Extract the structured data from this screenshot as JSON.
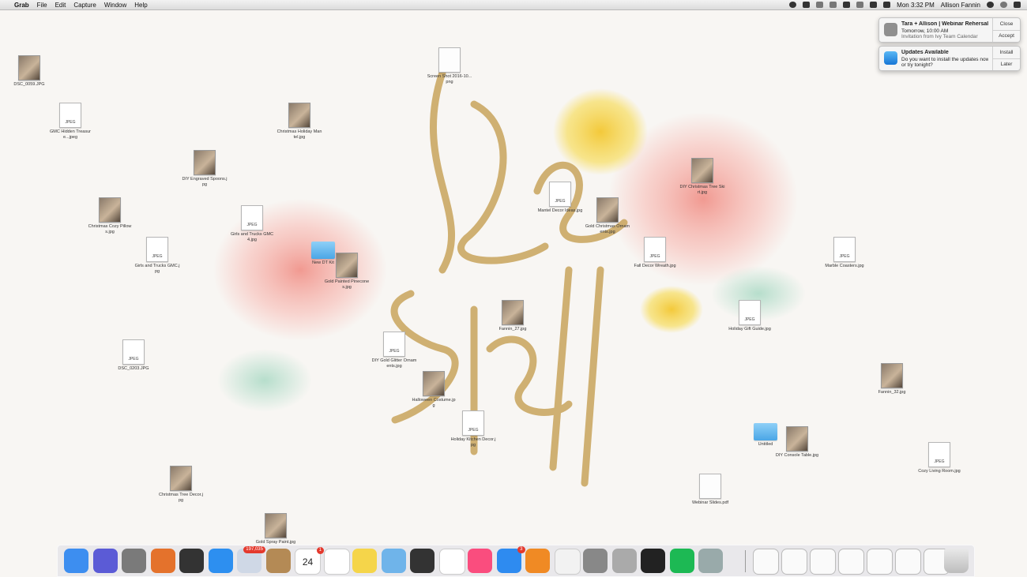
{
  "menubar": {
    "app_name": "Grab",
    "menus": [
      "File",
      "Edit",
      "Capture",
      "Window",
      "Help"
    ],
    "clock": "Mon 3:32 PM",
    "user": "Allison Fannin"
  },
  "notifications": {
    "webinar": {
      "title": "Tara + Allison | Webinar Rehersal",
      "line1": "Tomorrow, 10:00 AM",
      "line2": "Invitation from Ivy Team Calendar",
      "close_label": "Close",
      "accept_label": "Accept"
    },
    "updates": {
      "title": "Updates Available",
      "line1": "Do you want to install the updates now",
      "line2": "or try tonight?",
      "install_label": "Install",
      "later_label": "Later"
    }
  },
  "desktop": {
    "icons": [
      {
        "label": "DSC_0059.JPG",
        "kind": "photo"
      },
      {
        "label": "GMC Hidden Treasure...jpeg",
        "kind": "jpeg"
      },
      {
        "label": "Christmas Cozy Pillows.jpg",
        "kind": "photo"
      },
      {
        "label": "Girls and Trucks GMC.jpg",
        "kind": "jpeg"
      },
      {
        "label": "DIY Engraved Spoons.jpg",
        "kind": "photo"
      },
      {
        "label": "Girls and Trucks GMC 4.jpg",
        "kind": "jpeg"
      },
      {
        "label": "Christmas Holiday Mantel.jpg",
        "kind": "photo"
      },
      {
        "label": "Gold Painted Pinecones.jpg",
        "kind": "photo"
      },
      {
        "label": "New DT Kit",
        "kind": "folder"
      },
      {
        "label": "Screen Shot 2016-10...png",
        "kind": "blank"
      },
      {
        "label": "DIY Gold Glitter Ornaments.jpg",
        "kind": "jpeg"
      },
      {
        "label": "Halloween Costume.jpg",
        "kind": "photo"
      },
      {
        "label": "Holiday Kitchen Decor.jpg",
        "kind": "jpeg"
      },
      {
        "label": "Fannin_27.jpg",
        "kind": "photo"
      },
      {
        "label": "Mantel Decor Ideas.jpg",
        "kind": "jpeg"
      },
      {
        "label": "Gold Christmas Ornaments.jpg",
        "kind": "photo"
      },
      {
        "label": "Fall Decor Wreath.jpg",
        "kind": "jpeg"
      },
      {
        "label": "DIY Christmas Tree Skirt.jpg",
        "kind": "photo"
      },
      {
        "label": "Holiday Gift Guide.jpg",
        "kind": "jpeg"
      },
      {
        "label": "DIY Console Table.jpg",
        "kind": "photo"
      },
      {
        "label": "Marble Coasters.jpg",
        "kind": "jpeg"
      },
      {
        "label": "Fannin_32.jpg",
        "kind": "photo"
      },
      {
        "label": "Cozy Living Room.jpg",
        "kind": "jpeg"
      },
      {
        "label": "Christmas Tree Decor.jpg",
        "kind": "photo"
      },
      {
        "label": "DSC_0203.JPG",
        "kind": "jpeg"
      },
      {
        "label": "Untitled",
        "kind": "folder"
      },
      {
        "label": "Gold Spray Paint.jpg",
        "kind": "photo"
      },
      {
        "label": "Webinar Slides.pdf",
        "kind": "blank"
      }
    ]
  },
  "dock": {
    "apps": [
      {
        "name": "Finder",
        "icon": "finder-icon"
      },
      {
        "name": "Siri",
        "icon": "siri-icon"
      },
      {
        "name": "Launchpad",
        "icon": "launchpad-icon"
      },
      {
        "name": "Firefox",
        "icon": "firefox-icon"
      },
      {
        "name": "Photo Booth",
        "icon": "photobooth-icon"
      },
      {
        "name": "Safari",
        "icon": "safari-icon"
      },
      {
        "name": "Mail",
        "icon": "mail-icon",
        "badge": "197,035"
      },
      {
        "name": "Contacts",
        "icon": "contacts-icon"
      },
      {
        "name": "Calendar",
        "icon": "calendar-icon",
        "badge": "1",
        "text": "24"
      },
      {
        "name": "Reminders",
        "icon": "reminders-icon"
      },
      {
        "name": "Notes",
        "icon": "notes-icon"
      },
      {
        "name": "Preview",
        "icon": "preview-icon"
      },
      {
        "name": "Photo Slideshow",
        "icon": "slideshow-icon"
      },
      {
        "name": "Photos",
        "icon": "photos-icon"
      },
      {
        "name": "iTunes",
        "icon": "itunes-icon"
      },
      {
        "name": "App Store",
        "icon": "appstore-icon",
        "badge": "3"
      },
      {
        "name": "iBooks",
        "icon": "ibooks-icon"
      },
      {
        "name": "TextEdit",
        "icon": "textedit-icon"
      },
      {
        "name": "System Preferences",
        "icon": "gear-icon"
      },
      {
        "name": "Grab",
        "icon": "grab-icon"
      },
      {
        "name": "Activity Monitor",
        "icon": "activity-icon"
      },
      {
        "name": "Spotify",
        "icon": "spotify-icon"
      },
      {
        "name": "Image Capture",
        "icon": "capture-icon"
      }
    ]
  },
  "colors": {
    "folder": "#4aa6e6",
    "gold": "#c9a45c",
    "flower_yellow": "#f6dc52",
    "flower_pink": "#f2a7a0"
  }
}
